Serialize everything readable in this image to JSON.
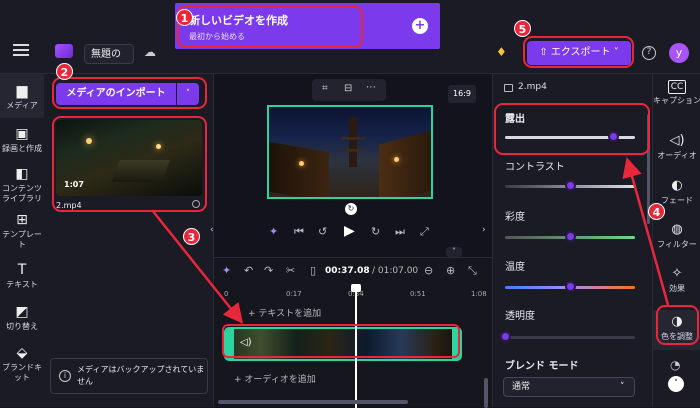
{
  "header": {
    "project_name": "無題の",
    "new_video_title": "新しいビデオを作成",
    "new_video_sub": "最初から始める",
    "export_label": "エクスポート",
    "avatar_initial": "y",
    "help": "?"
  },
  "left_nav": [
    {
      "label": "メディア",
      "icon": "folder-icon"
    },
    {
      "label": "録画と作成",
      "icon": "camera-icon"
    },
    {
      "label": "コンテンツライブラリ",
      "icon": "library-icon"
    },
    {
      "label": "テンプレート",
      "icon": "template-icon"
    },
    {
      "label": "テキスト",
      "icon": "text-icon"
    },
    {
      "label": "切り替え",
      "icon": "transition-icon"
    },
    {
      "label": "ブランドキット",
      "icon": "brand-icon"
    }
  ],
  "media": {
    "import_label": "メディアのインポート",
    "clip_duration": "1:07",
    "clip_name": "2.mp4",
    "backup_notice": "メディアはバックアップされていません"
  },
  "preview": {
    "aspect": "16:9"
  },
  "timeline": {
    "current_time": "00:37.08",
    "total_time": "/ 01:07.00",
    "ruler": [
      "0",
      "0:17",
      "0:34",
      "0:51",
      "1:08"
    ],
    "add_text": "+ テキストを追加",
    "add_audio": "+ オーディオを追加"
  },
  "properties": {
    "file_name": "2.mp4",
    "exposure": {
      "label": "露出",
      "value": 0.83
    },
    "contrast": {
      "label": "コントラスト",
      "value": 0.5
    },
    "saturation": {
      "label": "彩度",
      "value": 0.5
    },
    "temperature": {
      "label": "温度",
      "value": 0.5
    },
    "transparency": {
      "label": "透明度",
      "value": 0.0
    },
    "blend_mode_label": "ブレンド モード",
    "blend_mode_value": "通常"
  },
  "right_nav": [
    {
      "label": "キャプション",
      "icon": "cc-icon"
    },
    {
      "label": "オーディオ",
      "icon": "speaker-icon"
    },
    {
      "label": "フェード",
      "icon": "fade-icon"
    },
    {
      "label": "フィルター",
      "icon": "filter-icon"
    },
    {
      "label": "効果",
      "icon": "effects-icon"
    },
    {
      "label": "色を調整",
      "icon": "color-adjust-icon"
    }
  ],
  "annotations": [
    "1",
    "2",
    "3",
    "4",
    "5"
  ],
  "colors": {
    "accent": "#7c3aed",
    "annotation": "#e8283a",
    "clip_border": "#2dd4a0"
  }
}
